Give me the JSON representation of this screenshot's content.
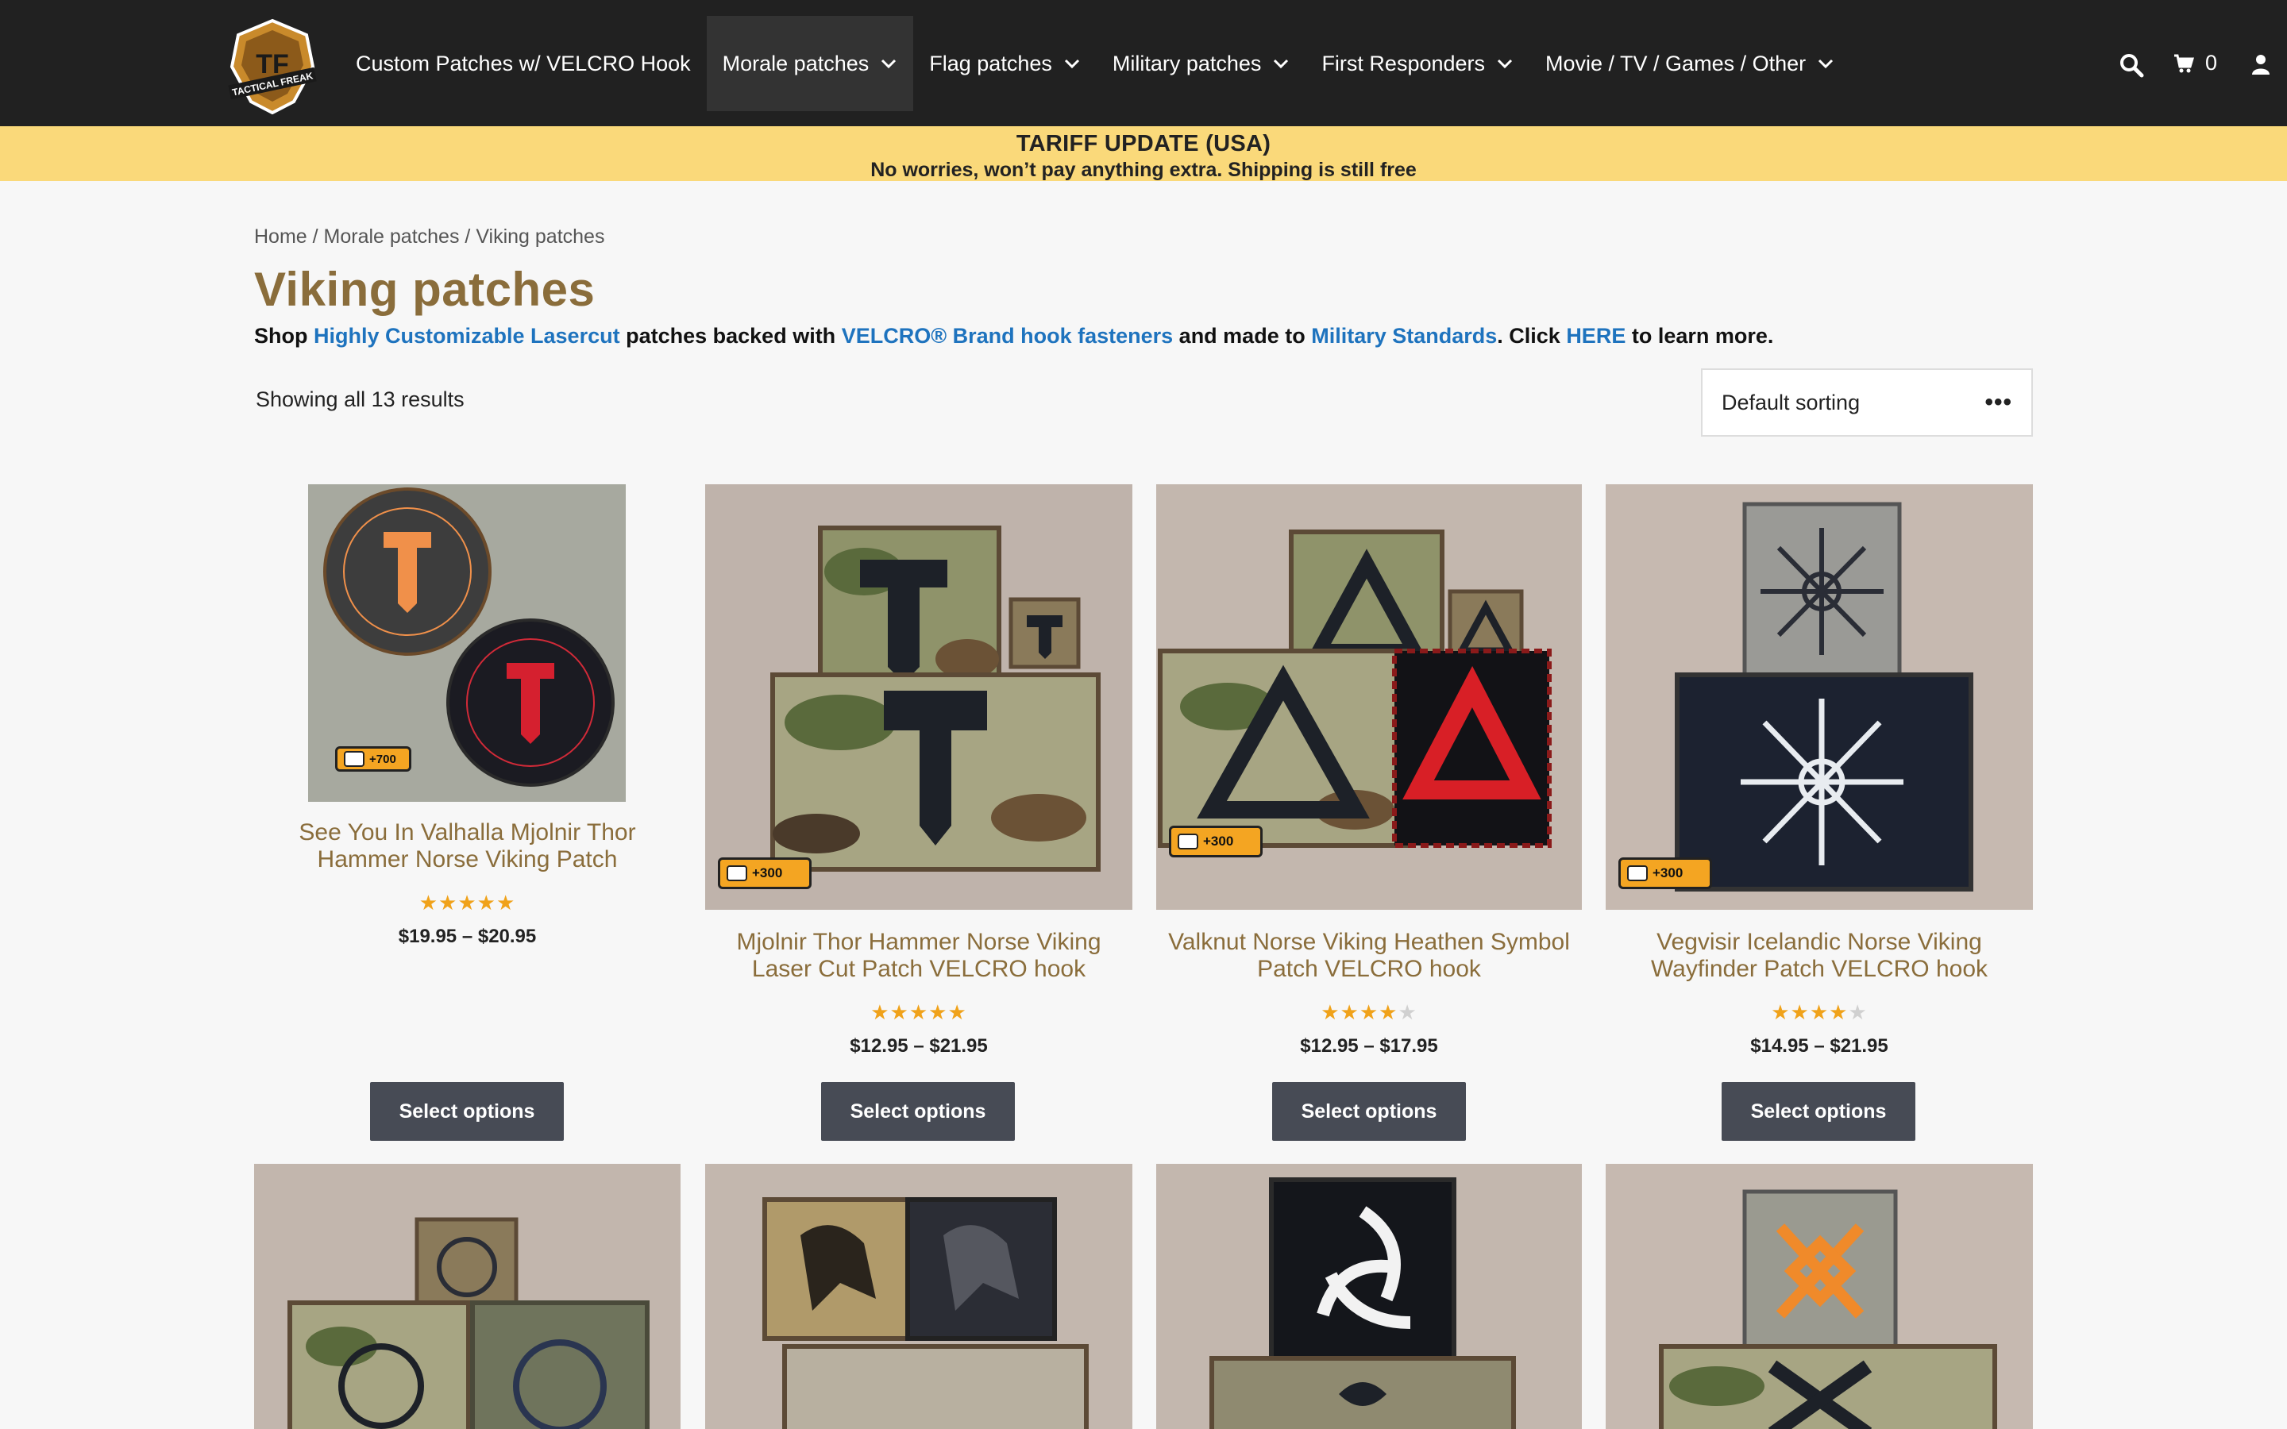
{
  "header": {
    "logo_text": "TACTICAL FREAK",
    "nav": [
      {
        "label": "Custom Patches w/ VELCRO Hook",
        "dropdown": false
      },
      {
        "label": "Morale patches",
        "dropdown": true,
        "active": true
      },
      {
        "label": "Flag patches",
        "dropdown": true
      },
      {
        "label": "Military patches",
        "dropdown": true
      },
      {
        "label": "First Responders",
        "dropdown": true
      },
      {
        "label": "Movie / TV / Games / Other",
        "dropdown": true
      }
    ],
    "cart_count": "0"
  },
  "banner": {
    "title": "TARIFF UPDATE (USA)",
    "subtitle": "No worries, won’t pay anything extra. Shipping is still free"
  },
  "breadcrumb": {
    "home": "Home",
    "sep1": " / ",
    "category": "Morale patches",
    "sep2": " / ",
    "current": "Viking patches"
  },
  "page": {
    "title": "Viking patches",
    "intro": {
      "t1": "Shop ",
      "l1": "Highly Customizable Lasercut",
      "t2": " patches backed with ",
      "l2": "VELCRO® Brand hook fasteners",
      "t3": " and made to ",
      "l3": "Military Standards",
      "t4": ". Click ",
      "l4": "HERE",
      "t5": " to learn more."
    },
    "result_count": "Showing all 13 results",
    "sorting": "Default sorting"
  },
  "products": [
    {
      "title_l1": "See You In Valhalla Mjolnir Thor",
      "title_l2": "Hammer Norse Viking Patch",
      "rating": 5,
      "price": "$19.95 – $20.95",
      "button": "Select options",
      "badge": "+700"
    },
    {
      "title_l1": "Mjolnir Thor Hammer Norse Viking",
      "title_l2": "Laser Cut Patch VELCRO hook",
      "rating": 4.8,
      "price": "$12.95 – $21.95",
      "button": "Select options",
      "badge": "+300"
    },
    {
      "title_l1": "Valknut Norse Viking Heathen Symbol",
      "title_l2": "Patch VELCRO hook",
      "rating": 4.5,
      "price": "$12.95 – $17.95",
      "button": "Select options",
      "badge": "+300"
    },
    {
      "title_l1": "Vegvisir Icelandic Norse Viking",
      "title_l2": "Wayfinder Patch VELCRO hook",
      "rating": 4,
      "price": "$14.95 – $21.95",
      "button": "Select options",
      "badge": "+300"
    }
  ],
  "colors": {
    "header_bg": "#212121",
    "banner_bg": "#fad97a",
    "title_brown": "#8a6d3b",
    "link_blue": "#1e73be",
    "button_bg": "#474b55",
    "star": "#f0a21a"
  }
}
